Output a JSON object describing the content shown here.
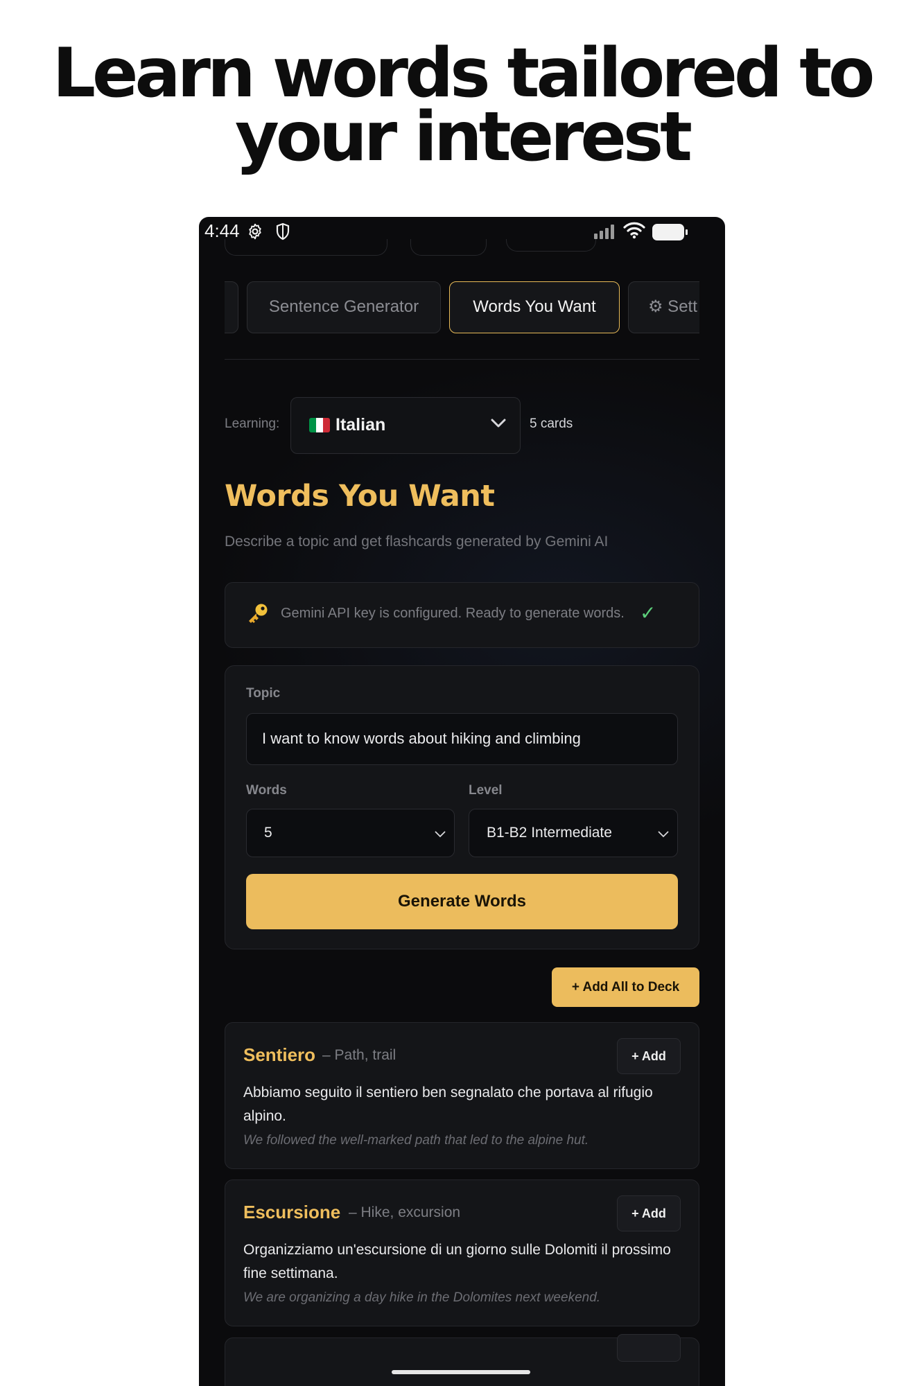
{
  "headline": {
    "line1": "Learn words tailored to",
    "line2": "your interest"
  },
  "status_bar": {
    "time": "4:44",
    "icons": [
      "gear-icon",
      "shield-icon",
      "signal-icon",
      "wifi-icon",
      "battery-icon"
    ]
  },
  "tabs": [
    {
      "label": ""
    },
    {
      "label": "Sentence Generator"
    },
    {
      "label": "Words You Want",
      "active": true
    },
    {
      "label": "⚙ Sett"
    }
  ],
  "learning": {
    "label": "Learning:",
    "language": "Italian",
    "flag_colors": [
      "#009246",
      "#ffffff",
      "#ce2b37"
    ],
    "cards_count": "5 cards"
  },
  "section": {
    "title": "Words You Want",
    "subtitle": "Describe a topic and get flashcards generated by Gemini AI"
  },
  "api_status": {
    "message": "Gemini API key is configured. Ready to generate words.",
    "status_icon": "check-icon"
  },
  "form": {
    "topic_label": "Topic",
    "topic_value": "I want to know words about hiking and climbing",
    "words_label": "Words",
    "words_value": "5",
    "level_label": "Level",
    "level_value": "B1-B2 Intermediate",
    "generate_label": "Generate Words"
  },
  "add_all_label": "+ Add All to Deck",
  "words": [
    {
      "term": "Sentiero",
      "gloss": "– Path, trail",
      "add_label": "+ Add",
      "example": "Abbiamo seguito il sentiero ben segnalato che portava al rifugio alpino.",
      "translation": "We followed the well-marked path that led to the alpine hut."
    },
    {
      "term": "Escursione",
      "gloss": "– Hike, excursion",
      "add_label": "+ Add",
      "example": "Organizziamo un'escursione di un giorno sulle Dolomiti il prossimo fine settimana.",
      "translation": "We are organizing a day hike in the Dolomites next weekend."
    }
  ],
  "colors": {
    "accent": "#ecbc5d",
    "background": "#0b0b0d",
    "success": "#5ccf7b"
  }
}
